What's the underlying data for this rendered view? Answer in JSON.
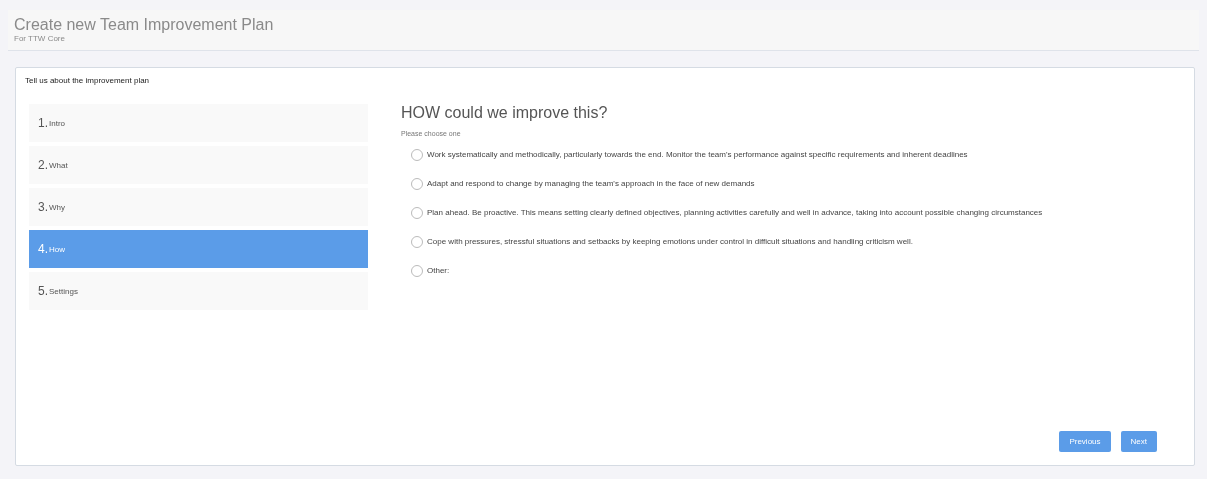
{
  "header": {
    "title": "Create new Team Improvement Plan",
    "subtitle": "For TTW Core"
  },
  "card": {
    "title": "Tell us about the improvement plan"
  },
  "steps": [
    {
      "number": "1.",
      "label": "Intro",
      "selected": false
    },
    {
      "number": "2.",
      "label": "What",
      "selected": false
    },
    {
      "number": "3.",
      "label": "Why",
      "selected": false
    },
    {
      "number": "4.",
      "label": "How",
      "selected": true
    },
    {
      "number": "5.",
      "label": "Settings",
      "selected": false
    }
  ],
  "question": {
    "heading": "HOW could we improve this?",
    "hint": "Please choose one"
  },
  "options": [
    {
      "label": "Work systematically and methodically, particularly towards the end. Monitor the team's performance against specific requirements and inherent deadlines",
      "selected": false
    },
    {
      "label": "Adapt and respond to change by managing the team's approach in the face of new demands",
      "selected": false
    },
    {
      "label": "Plan ahead. Be proactive. This means setting clearly defined objectives, planning activities carefully and well in advance, taking into account possible changing circumstances",
      "selected": false
    },
    {
      "label": "Cope with pressures, stressful situations and setbacks by keeping emotions under control in difficult situations and handling criticism well.",
      "selected": false
    },
    {
      "label": "Other:",
      "selected": false
    }
  ],
  "buttons": [
    {
      "label": "Previous"
    },
    {
      "label": "Next"
    }
  ]
}
